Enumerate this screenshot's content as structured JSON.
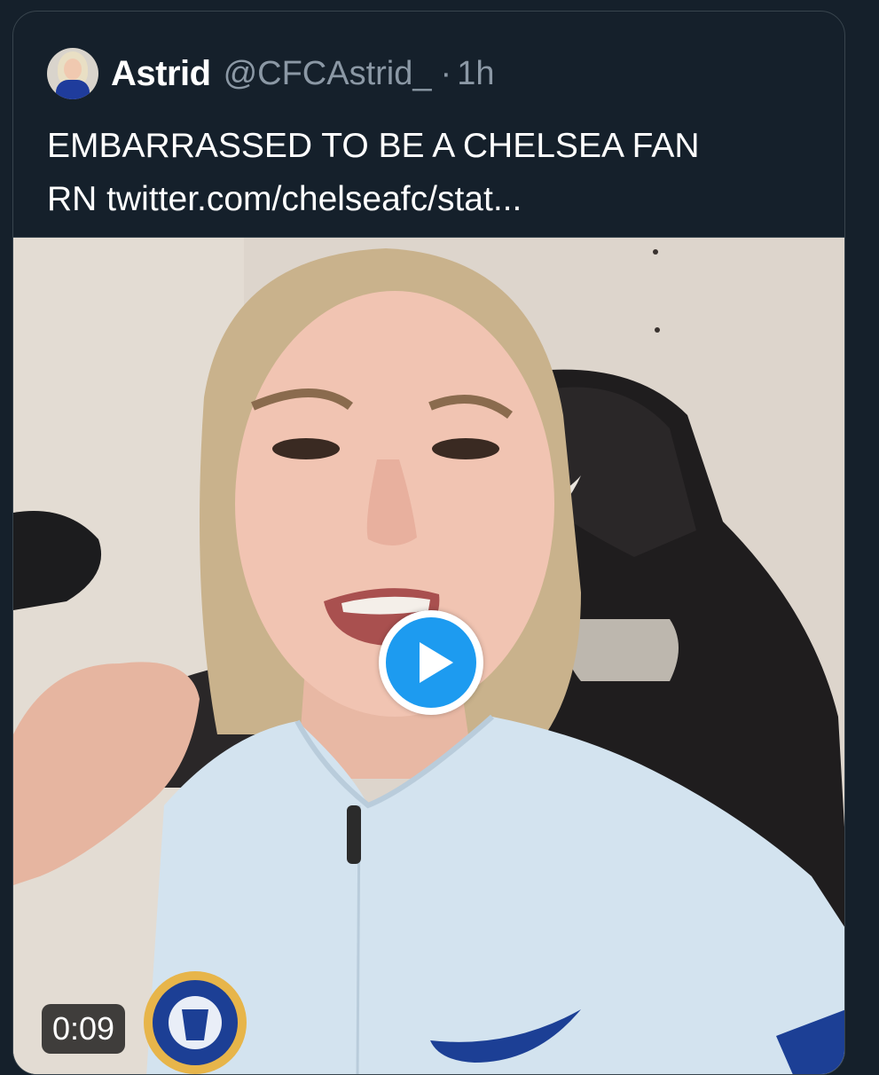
{
  "tweet": {
    "author_name": "Astrid",
    "handle": "@CFCAstrid_",
    "separator": "·",
    "timestamp": "1h",
    "text_line1": "EMBARRASSED TO BE A CHELSEA FAN",
    "text_line2_prefix": "RN ",
    "link_text": "twitter.com/chelseafc/stat..."
  },
  "media": {
    "type": "video",
    "duration": "0:09",
    "play_icon": "play-icon"
  },
  "colors": {
    "background": "#15202b",
    "border": "#38444d",
    "secondary_text": "#8b98a5",
    "play_accent": "#1d9bf0"
  }
}
